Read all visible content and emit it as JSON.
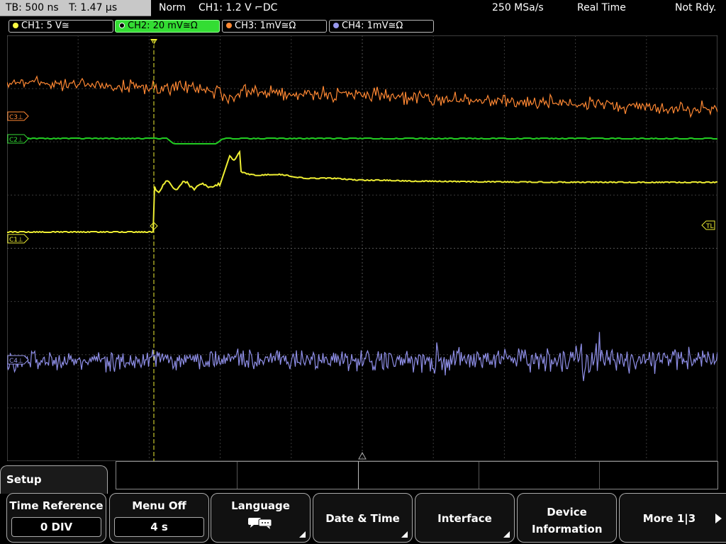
{
  "status": {
    "timebase": "TB: 500 ns",
    "trigger_time": "T: 1.47 µs",
    "mode": "Norm",
    "trigger": "CH1: 1.2 V ⌐DC",
    "sample_rate": "250 MSa/s",
    "acq_mode": "Real Time",
    "state": "Not Rdy."
  },
  "channels": [
    {
      "label": "CH1: 5 V≅",
      "color": "#ffff44",
      "active": false
    },
    {
      "label": "CH2: 20 mV≅Ω",
      "color": "#33dd33",
      "active": true
    },
    {
      "label": "CH3: 1mV≅Ω",
      "color": "#ff8833",
      "active": false
    },
    {
      "label": "CH4: 1mV≅Ω",
      "color": "#9999ee",
      "active": false
    }
  ],
  "markers": {
    "c3": "C3⊥",
    "c2": "C2⊥",
    "c1": "C1⊥",
    "c4": "C4⊥",
    "trigger_level": "TL",
    "trigger_top": "T"
  },
  "menu": {
    "title": "Setup",
    "softkeys": [
      {
        "label": "Time Reference",
        "value": "0 DIV"
      },
      {
        "label": "Menu Off",
        "value": "4 s"
      },
      {
        "label": "Language",
        "icon": "speech-bubble-icon"
      },
      {
        "label": "Date & Time"
      },
      {
        "label": "Interface"
      },
      {
        "label": "Device Information"
      },
      {
        "label": "More 1|3"
      }
    ]
  }
}
